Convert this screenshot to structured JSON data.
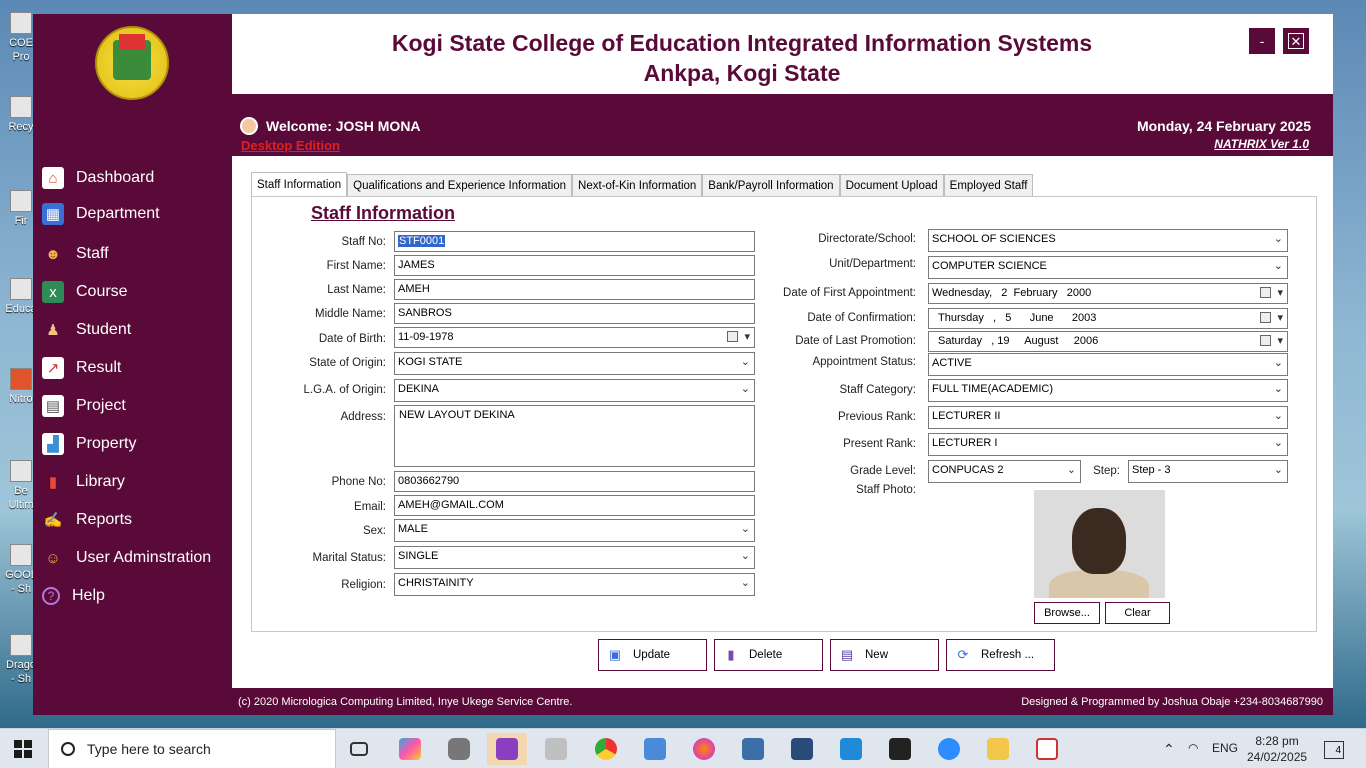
{
  "desktop": {
    "icons": [
      {
        "label": "COE Pro",
        "icon": "app-icon"
      },
      {
        "label": "Recy",
        "icon": "recycle-bin-icon"
      },
      {
        "label": "Fir",
        "icon": "app-icon"
      },
      {
        "label": "Educa",
        "icon": "app-icon"
      },
      {
        "label": "Nitro",
        "icon": "pdf-icon"
      },
      {
        "label": "Be Ultim",
        "icon": "app-icon"
      },
      {
        "label": "GOOL - Sh",
        "icon": "app-icon"
      },
      {
        "label": "Drago - Sh",
        "icon": "app-icon"
      }
    ]
  },
  "app": {
    "title_line1": "Kogi State College of Education Integrated Information Systems",
    "title_line2": "Ankpa, Kogi State",
    "minimize_label": "-",
    "close_label": "✕",
    "welcome": "Welcome: JOSH MONA",
    "edition": "Desktop Edition",
    "date": "Monday, 24 February 2025",
    "version": "NATHRIX Ver 1.0",
    "brand_color": "#5a0a38"
  },
  "sidebar": {
    "items": [
      {
        "label": "Dashboard",
        "icon": "home-icon"
      },
      {
        "label": "Department",
        "icon": "building-icon"
      },
      {
        "label": "Staff",
        "icon": "people-icon"
      },
      {
        "label": "Course",
        "icon": "spreadsheet-icon"
      },
      {
        "label": "Student",
        "icon": "graduate-icon"
      },
      {
        "label": "Result",
        "icon": "chart-icon"
      },
      {
        "label": "Project",
        "icon": "project-icon"
      },
      {
        "label": "Property",
        "icon": "property-icon"
      },
      {
        "label": "Library",
        "icon": "book-icon"
      },
      {
        "label": "Reports",
        "icon": "reports-icon"
      },
      {
        "label": "User Adminstration",
        "icon": "user-add-icon"
      },
      {
        "label": "Help",
        "icon": "help-icon"
      }
    ]
  },
  "tabs": [
    {
      "label": "Staff Information",
      "active": true
    },
    {
      "label": "Qualifications and Experience Information",
      "active": false
    },
    {
      "label": "Next-of-Kin Information",
      "active": false
    },
    {
      "label": "Bank/Payroll Information",
      "active": false
    },
    {
      "label": "Document Upload",
      "active": false
    },
    {
      "label": "Employed Staff",
      "active": false
    }
  ],
  "form": {
    "section_title": "Staff Information",
    "left": {
      "staff_no": {
        "label": "Staff No:",
        "value": "STF0001"
      },
      "first_name": {
        "label": "First Name:",
        "value": "JAMES"
      },
      "last_name": {
        "label": "Last Name:",
        "value": "AMEH"
      },
      "middle_name": {
        "label": "Middle Name:",
        "value": "SANBROS"
      },
      "dob": {
        "label": "Date of Birth:",
        "value": "11-09-1978"
      },
      "state": {
        "label": "State of Origin:",
        "value": "KOGI STATE"
      },
      "lga": {
        "label": "L.G.A. of Origin:",
        "value": "DEKINA"
      },
      "address": {
        "label": "Address:",
        "value": "NEW LAYOUT DEKINA"
      },
      "phone": {
        "label": "Phone No:",
        "value": "0803662790"
      },
      "email": {
        "label": "Email:",
        "value": "AMEH@GMAIL.COM"
      },
      "sex": {
        "label": "Sex:",
        "value": "MALE"
      },
      "marital": {
        "label": "Marital Status:",
        "value": "SINGLE"
      },
      "religion": {
        "label": "Religion:",
        "value": "CHRISTAINITY"
      }
    },
    "right": {
      "directorate": {
        "label": "Directorate/School:",
        "value": "SCHOOL OF SCIENCES"
      },
      "unit": {
        "label": "Unit/Department:",
        "value": "COMPUTER SCIENCE"
      },
      "first_appt": {
        "label": "Date of First Appointment:",
        "value": "Wednesday,   2  February   2000"
      },
      "confirmation": {
        "label": "Date of Confirmation:",
        "value": "Thursday   ,   5      June      2003"
      },
      "last_promo": {
        "label": "Date of Last Promotion:",
        "value": "Saturday   , 19     August     2006"
      },
      "appt_status": {
        "label": "Appointment Status:",
        "value": "ACTIVE"
      },
      "category": {
        "label": "Staff Category:",
        "value": "FULL TIME(ACADEMIC)"
      },
      "prev_rank": {
        "label": "Previous Rank:",
        "value": "LECTURER II"
      },
      "present_rank": {
        "label": "Present Rank:",
        "value": "LECTURER I"
      },
      "grade": {
        "label": "Grade Level:",
        "value": "CONPUCAS 2"
      },
      "step": {
        "label": "Step:",
        "value": "Step - 3"
      },
      "photo_label": "Staff Photo:",
      "browse": "Browse...",
      "clear": "Clear"
    }
  },
  "actions": [
    {
      "label": "Update",
      "icon": "save-icon"
    },
    {
      "label": "Delete",
      "icon": "trash-icon"
    },
    {
      "label": "New",
      "icon": "new-document-icon"
    },
    {
      "label": "Refresh ...",
      "icon": "refresh-icon"
    }
  ],
  "footer": {
    "copyright": "(c) 2020 Micrologica Computing Limited, Inye Ukege Service Centre.",
    "designer": "Designed & Programmed by Joshua Obaje +234-8034687990"
  },
  "taskbar": {
    "search_placeholder": "Type here to search",
    "language": "ENG",
    "time": "8:28 pm",
    "date": "24/02/2025",
    "notifications": "4",
    "apps": [
      "task-view-icon",
      "copilot-icon",
      "database-icon",
      "visual-studio-icon",
      "tool-icon",
      "chrome-icon",
      "network-icon",
      "firefox-icon",
      "python-icon",
      "sql-icon",
      "vscode-icon",
      "terminal-icon",
      "zoom-icon",
      "file-explorer-icon",
      "app-icon"
    ]
  }
}
